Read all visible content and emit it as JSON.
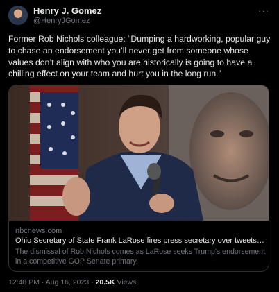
{
  "author": {
    "name": "Henry J. Gomez",
    "handle": "@HenryJGomez"
  },
  "more_menu": "···",
  "tweet_text": "Former Rob Nichols colleague: “Dumping a hardworking, popular guy to chase an endorsement you’ll never get from someone whose values don’t align with who you are historically is going to have a chilling effect on your team and hurt you in the long run.”",
  "link_card": {
    "image": "photo of speaker in suit holding microphone",
    "domain": "nbcnews.com",
    "title": "Ohio Secretary of State Frank LaRose fires press secretary over tweets critici…",
    "description": "The dismissal of Rob Nichols comes as LaRose seeks Trump's endorsement in a competitive GOP Senate primary."
  },
  "meta": {
    "time": "12:48 PM",
    "separator": "·",
    "date": "Aug 16, 2023",
    "views_count": "20.5K",
    "views_label": "Views"
  },
  "colors": {
    "background": "#000000",
    "text": "#e7e9ea",
    "secondary": "#71767b",
    "border": "#2f3336"
  }
}
